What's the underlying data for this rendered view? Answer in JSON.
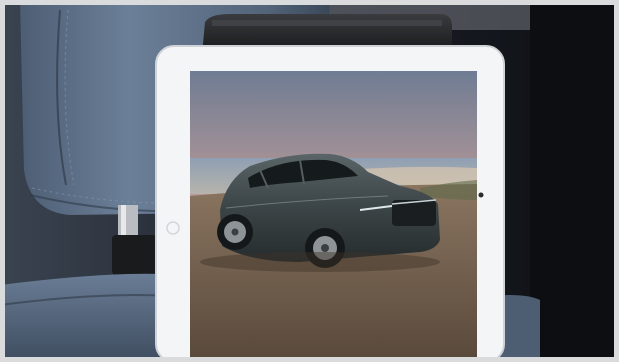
{
  "scene": {
    "subject": "tablet-headrest-mount",
    "colors": {
      "cabin": "#2a313b",
      "leather": "#5d6f86",
      "leather_dark": "#3c4a5c",
      "mount": "#1e1f21",
      "tablet_bezel": "#f3f4f5",
      "screen_sky_top": "#78849a",
      "screen_sky_bottom": "#e4b08c",
      "vehicle": "#414a4d",
      "ground": "#6e5c4b"
    },
    "icons": [
      "camera-dot-icon",
      "home-button-icon"
    ]
  }
}
